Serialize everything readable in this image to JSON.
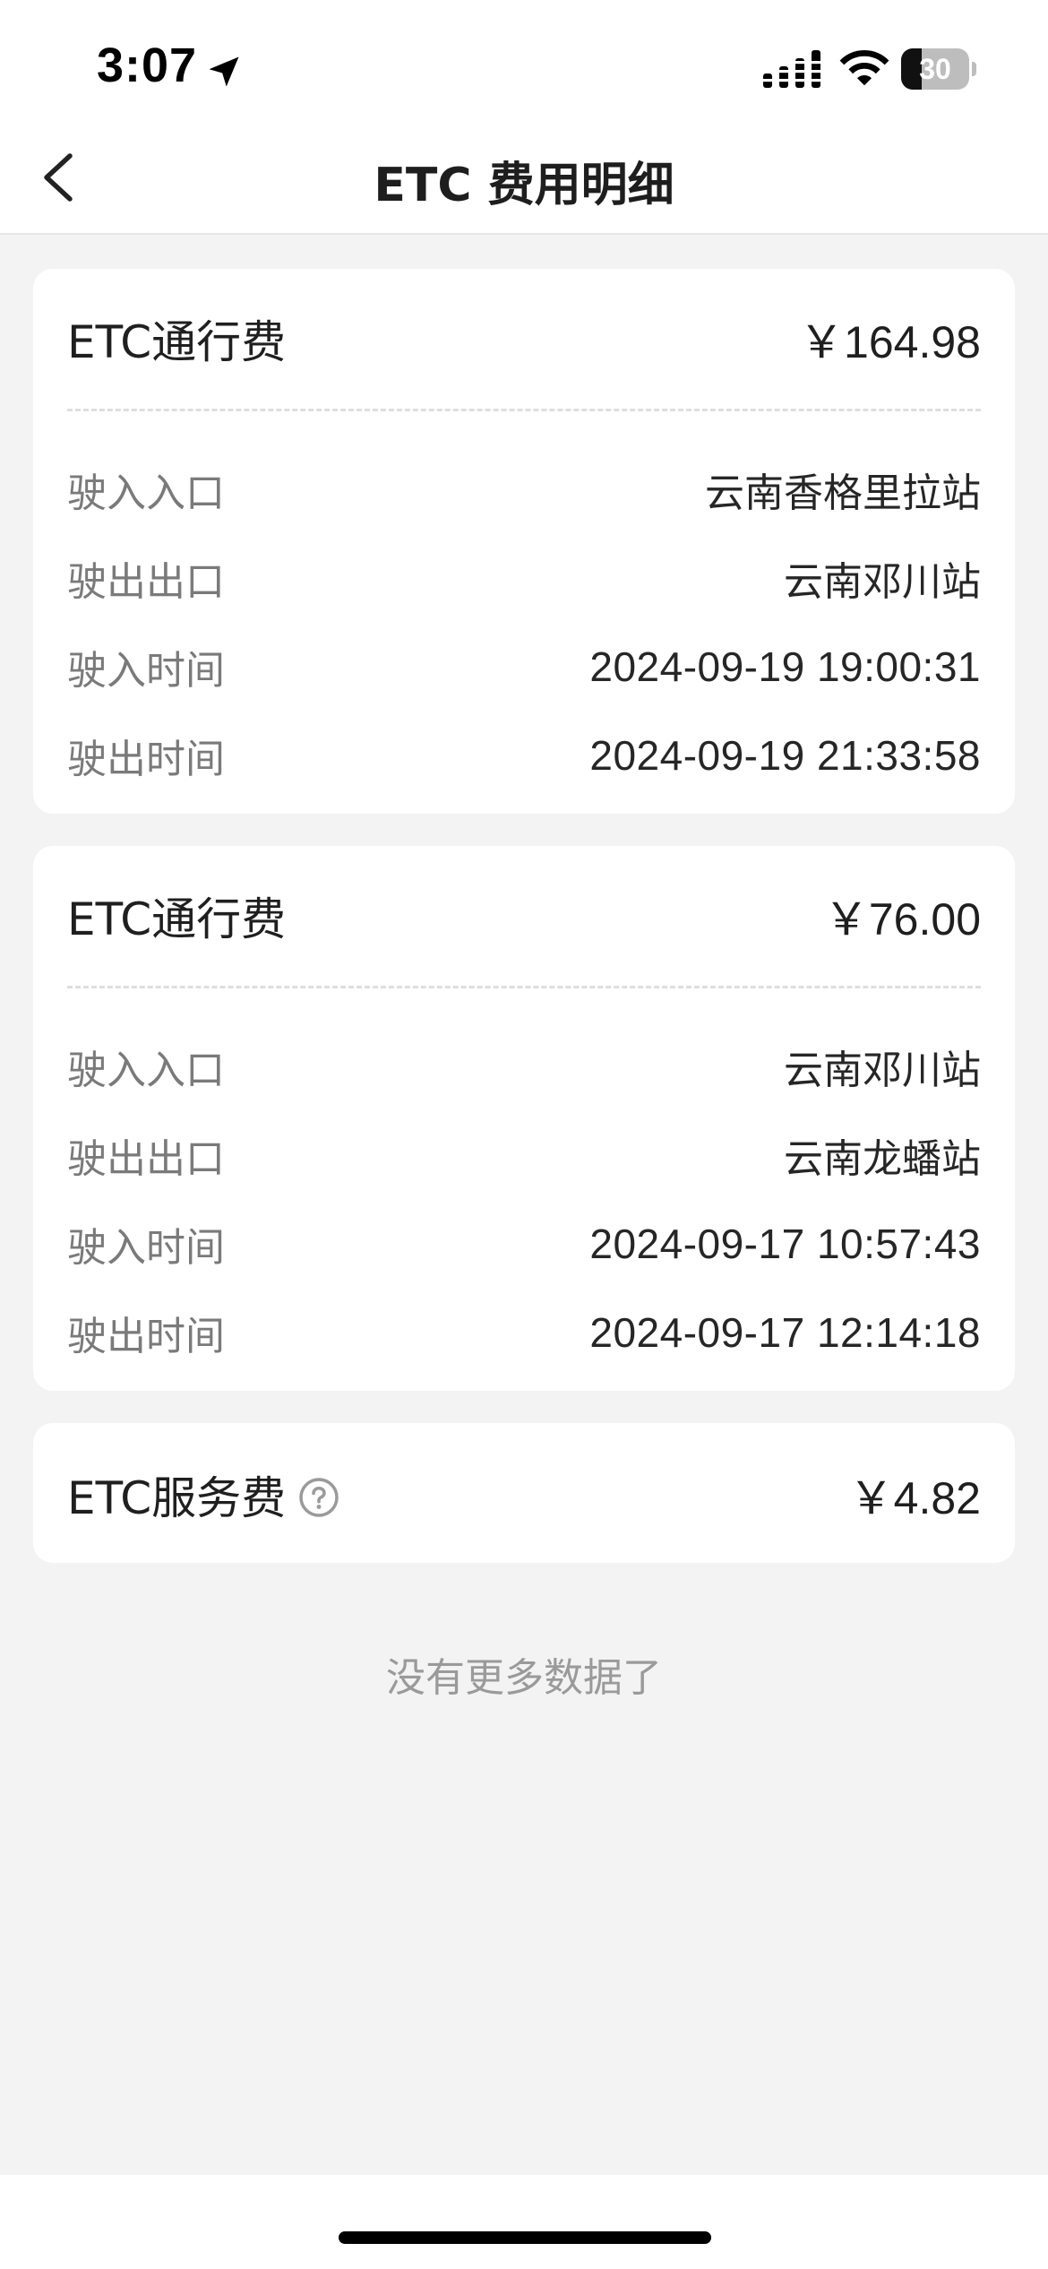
{
  "status_bar": {
    "time": "3:07",
    "battery_level": "30",
    "battery_fraction": 0.3,
    "icons": [
      "location-arrow-icon",
      "cellular-signal-icon",
      "wifi-icon",
      "battery-icon"
    ]
  },
  "nav": {
    "back_icon": "chevron-left-icon",
    "title": "ETC 费用明细"
  },
  "records": [
    {
      "title": "ETC通行费",
      "amount": "￥164.98",
      "rows": [
        {
          "label": "驶入入口",
          "value": "云南香格里拉站"
        },
        {
          "label": "驶出出口",
          "value": "云南邓川站"
        },
        {
          "label": "驶入时间",
          "value": "2024-09-19 19:00:31"
        },
        {
          "label": "驶出时间",
          "value": "2024-09-19 21:33:58"
        }
      ]
    },
    {
      "title": "ETC通行费",
      "amount": "￥76.00",
      "rows": [
        {
          "label": "驶入入口",
          "value": "云南邓川站"
        },
        {
          "label": "驶出出口",
          "value": "云南龙蟠站"
        },
        {
          "label": "驶入时间",
          "value": "2024-09-17 10:57:43"
        },
        {
          "label": "驶出时间",
          "value": "2024-09-17 12:14:18"
        }
      ]
    }
  ],
  "service_fee": {
    "title": "ETC服务费",
    "amount": "￥4.82",
    "help_icon": "question-circle-icon"
  },
  "footer": {
    "no_more_text": "没有更多数据了"
  }
}
